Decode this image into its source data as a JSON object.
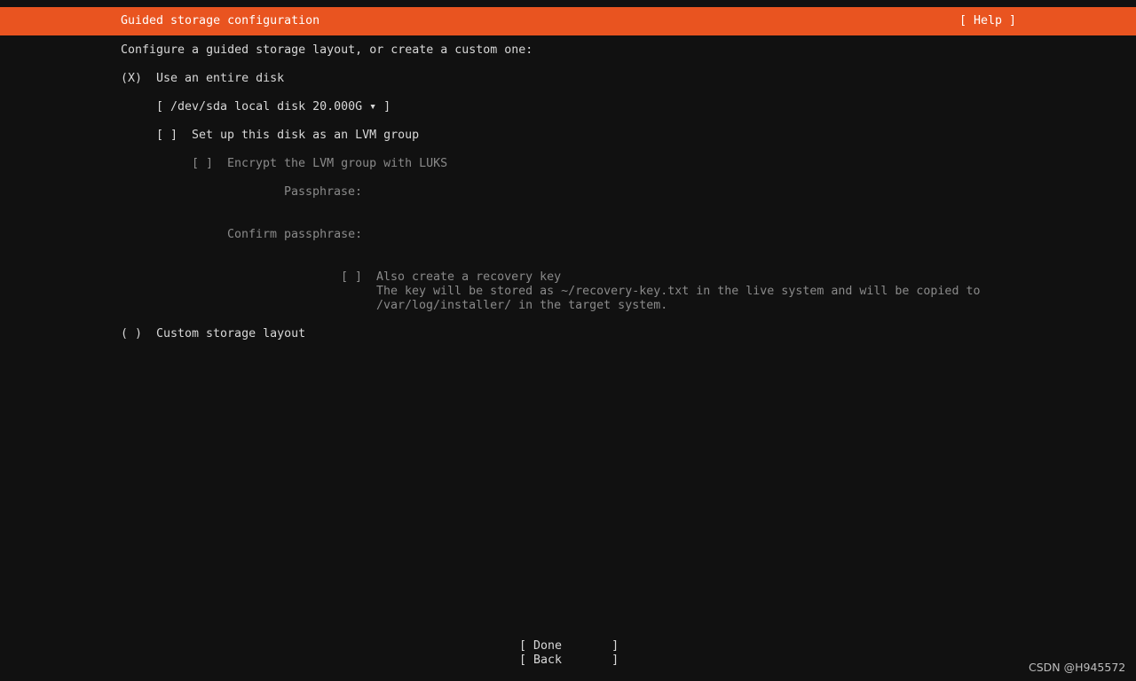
{
  "colors": {
    "background": "#111111",
    "header_bar": "#e95420",
    "text": "#d8d8d8",
    "text_disabled": "#8a8a8a"
  },
  "header": {
    "title": "Guided storage configuration",
    "help_label": "[ Help ]"
  },
  "intro": "Configure a guided storage layout, or create a custom one:",
  "entire_disk": {
    "radio": "(X)",
    "label": "Use an entire disk",
    "disk_select": "[ /dev/sda local disk 20.000G ▾ ]",
    "lvm_checkbox": "[ ]",
    "lvm_label": "Set up this disk as an LVM group",
    "encrypt_checkbox": "[ ]",
    "encrypt_label": "Encrypt the LVM group with LUKS",
    "passphrase_label": "Passphrase:",
    "passphrase_value": "",
    "confirm_label": "Confirm passphrase:",
    "confirm_value": "",
    "recovery_checkbox": "[ ]",
    "recovery_label": "Also create a recovery key",
    "recovery_help_line1": "The key will be stored as ~/recovery-key.txt in the live system and will be copied to",
    "recovery_help_line2": "/var/log/installer/ in the target system."
  },
  "custom_layout": {
    "radio": "( )",
    "label": "Custom storage layout"
  },
  "buttons": {
    "done": "[ Done       ]",
    "back": "[ Back       ]"
  },
  "watermark": "CSDN @H945572"
}
